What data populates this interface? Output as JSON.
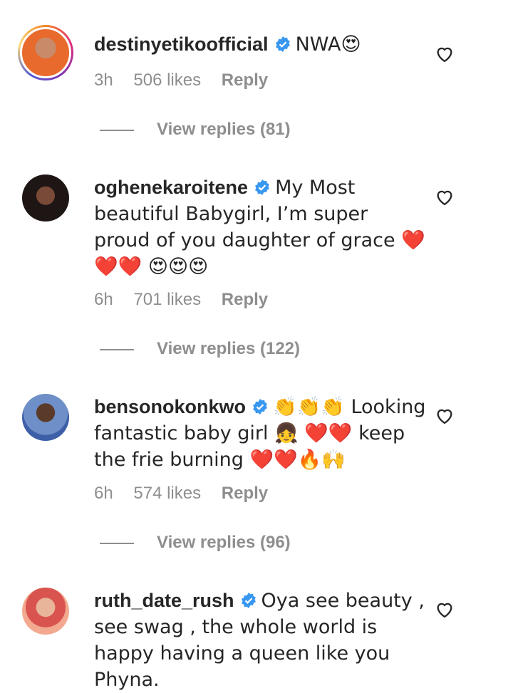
{
  "comments": [
    {
      "username": "destinyetikoofficial",
      "text": "NWA😍",
      "time": "3h",
      "likes": "506 likes",
      "reply_label": "Reply",
      "view_replies": "View replies (81)",
      "avatar_color": "#e86a2c"
    },
    {
      "username": "oghenekaroitene",
      "text": "My Most beautiful Babygirl, I’m super proud of you daughter of grace ❤️❤️❤️ 😍😍😍",
      "time": "6h",
      "likes": "701 likes",
      "reply_label": "Reply",
      "view_replies": "View replies (122)",
      "avatar_color": "#2a1d1a"
    },
    {
      "username": "bensonokonkwo",
      "text": "👏👏👏 Looking fantastic baby girl 👧 ❤️❤️ keep the frie burning ❤️❤️🔥🙌",
      "time": "6h",
      "likes": "574 likes",
      "reply_label": "Reply",
      "view_replies": "View replies (96)",
      "avatar_color": "#3d5fa8"
    },
    {
      "username": "ruth_date_rush",
      "text": "Oya see beauty , see swag , the whole world is happy having a queen like you Phyna.",
      "time": "",
      "likes": "",
      "reply_label": "",
      "view_replies": "",
      "avatar_color": "#e07a6a"
    }
  ],
  "colors": {
    "verified": "#3897f0",
    "meta": "#8e8e8e",
    "text": "#262626"
  },
  "icons": {
    "verified": "verified-badge-icon",
    "like": "heart-outline-icon"
  }
}
